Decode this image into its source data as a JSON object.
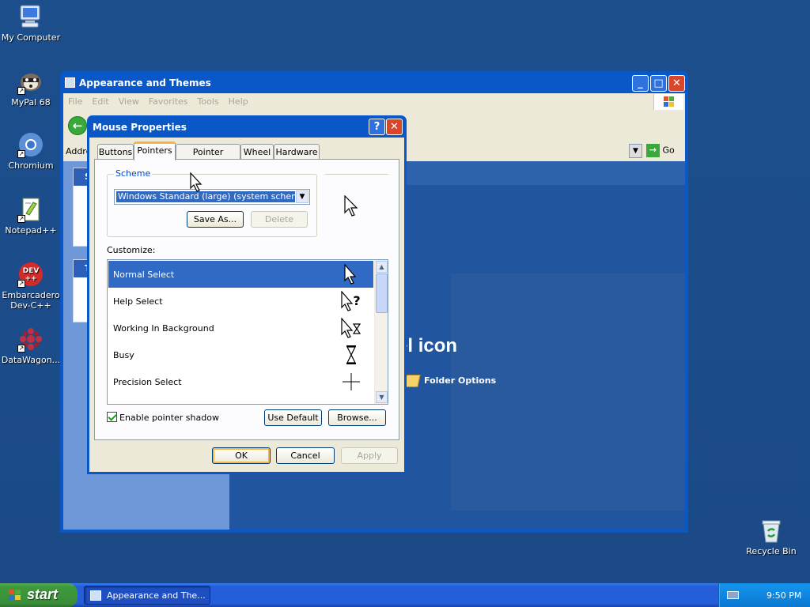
{
  "desktop": {
    "icons": [
      {
        "label": "My Computer",
        "icon": "computer-icon"
      },
      {
        "label": "MyPal 68",
        "icon": "mypal-icon"
      },
      {
        "label": "Chromium",
        "icon": "chromium-icon"
      },
      {
        "label": "Notepad++",
        "icon": "notepad-icon"
      },
      {
        "label": "Embarcadero Dev-C++",
        "icon": "devcpp-icon"
      },
      {
        "label": "DataWagon...",
        "icon": "datawagon-icon"
      }
    ],
    "recycle_bin": "Recycle Bin"
  },
  "explorer": {
    "title": "Appearance and Themes",
    "menu": [
      "File",
      "Edit",
      "View",
      "Favorites",
      "Tools",
      "Help"
    ],
    "address_label": "Address",
    "go_label": "Go",
    "pick_title": "ol Panel icon",
    "folder_options": "Folder Options",
    "left_box1_letter": "S",
    "left_box2_letter": "T"
  },
  "dialog": {
    "title": "Mouse Properties",
    "help_glyph": "?",
    "close_glyph": "✕",
    "tabs": [
      "Buttons",
      "Pointers",
      "Pointer Options",
      "Wheel",
      "Hardware"
    ],
    "active_tab": "Pointers",
    "scheme_label": "Scheme",
    "scheme_value": "Windows Standard (large) (system scheme)",
    "save_as": "Save As...",
    "delete": "Delete",
    "customize_label": "Customize:",
    "pointers": [
      {
        "name": "Normal Select",
        "icon": "arrow-cursor-icon",
        "selected": true
      },
      {
        "name": "Help Select",
        "icon": "help-cursor-icon",
        "selected": false
      },
      {
        "name": "Working In Background",
        "icon": "working-cursor-icon",
        "selected": false
      },
      {
        "name": "Busy",
        "icon": "hourglass-cursor-icon",
        "selected": false
      },
      {
        "name": "Precision Select",
        "icon": "crosshair-cursor-icon",
        "selected": false
      }
    ],
    "shadow_label": "Enable pointer shadow",
    "shadow_checked": true,
    "use_default": "Use Default",
    "browse": "Browse...",
    "ok": "OK",
    "cancel": "Cancel",
    "apply": "Apply"
  },
  "taskbar": {
    "start": "start",
    "task_label": "Appearance and The...",
    "clock": "9:50 PM"
  },
  "colors": {
    "desktop": "#1c4c8c",
    "titlebar": "#0a58c8",
    "selection": "#316ac5",
    "start": "#3a8e3a"
  }
}
